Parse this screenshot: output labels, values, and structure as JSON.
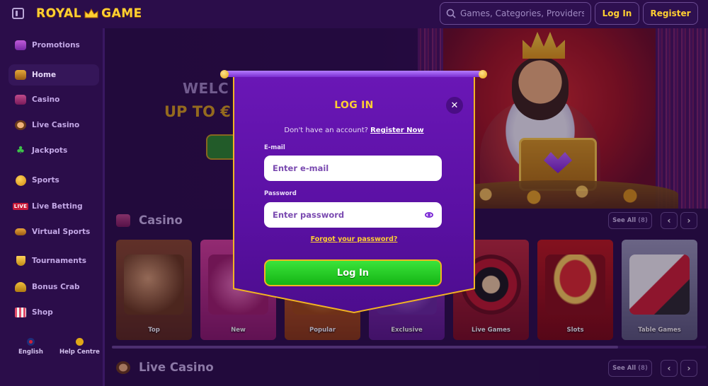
{
  "header": {
    "logo_text_left": "ROYAL",
    "logo_text_right": "GAME",
    "search_placeholder": "Games, Categories, Providers",
    "login_label": "Log In",
    "register_label": "Register"
  },
  "sidebar": {
    "items": [
      {
        "label": "Promotions",
        "icon": "gift-icon"
      },
      {
        "label": "Home",
        "icon": "treasure-chest-icon",
        "active": true
      },
      {
        "label": "Casino",
        "icon": "slot-machine-icon"
      },
      {
        "label": "Live Casino",
        "icon": "dealer-icon"
      },
      {
        "label": "Jackpots",
        "icon": "clover-icon"
      },
      {
        "label": "Sports",
        "icon": "ball-icon"
      },
      {
        "label": "Live Betting",
        "icon": "live-badge-icon",
        "badge": "LIVE"
      },
      {
        "label": "Virtual Sports",
        "icon": "gamepad-icon"
      },
      {
        "label": "Tournaments",
        "icon": "trophy-icon"
      },
      {
        "label": "Bonus Crab",
        "icon": "crab-icon"
      },
      {
        "label": "Shop",
        "icon": "shop-icon"
      }
    ],
    "footer": {
      "language_label": "English",
      "help_label": "Help Centre"
    }
  },
  "hero": {
    "line1": "WELC",
    "line2": "UP TO €"
  },
  "casino_section": {
    "title": "Casino",
    "see_all_label": "See All",
    "see_all_count": "(8)",
    "categories": [
      {
        "label": "Top",
        "color": "#7a3a2a"
      },
      {
        "label": "New",
        "color": "#b02e82"
      },
      {
        "label": "Popular",
        "color": "#b04a1a"
      },
      {
        "label": "Exclusive",
        "color": "#7a2a9a"
      },
      {
        "label": "Live Games",
        "color": "#9a1a2a"
      },
      {
        "label": "Slots",
        "color": "#a01818"
      },
      {
        "label": "Table Games",
        "color": "#6a6a90"
      }
    ]
  },
  "live_casino_section": {
    "title": "Live Casino",
    "see_all_label": "See All",
    "see_all_count": "(8)"
  },
  "login_modal": {
    "title": "LOG IN",
    "no_account_text": "Don't have an account?",
    "register_link": "Register Now",
    "email_label": "E-mail",
    "email_placeholder": "Enter e-mail",
    "password_label": "Password",
    "password_placeholder": "Enter password",
    "forgot_link": "Forgot your password?",
    "submit_label": "Log In"
  },
  "colors": {
    "accent_gold": "#ffcf32",
    "modal_purple": "#5a10a3",
    "submit_green": "#14b514",
    "background": "#2a0e47"
  }
}
